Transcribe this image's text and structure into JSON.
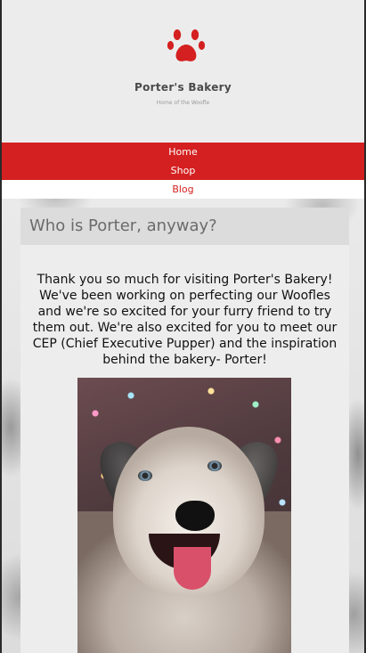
{
  "header": {
    "brand": "Porter's Bakery",
    "tagline": "Home of the Woofle",
    "logo_icon": "paw-print-icon",
    "logo_color": "#d42020"
  },
  "nav": {
    "items": [
      {
        "label": "Home",
        "active": false
      },
      {
        "label": "Shop",
        "active": false
      },
      {
        "label": "Blog",
        "active": true
      }
    ],
    "accent": "#d42020"
  },
  "main": {
    "title": "Who is Porter, anyway?",
    "intro": "Thank you so much for visiting Porter's Bakery! We've been working on perfecting our Woofles and we're so excited for your furry friend to try them out. We're also excited for you to meet our CEP (Chief Executive Pupper) and the inspiration behind the bakery- Porter!"
  }
}
